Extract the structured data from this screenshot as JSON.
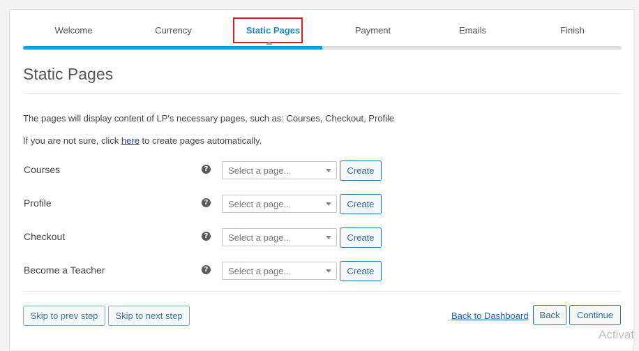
{
  "steps": [
    {
      "label": "Welcome"
    },
    {
      "label": "Currency"
    },
    {
      "label": "Static Pages",
      "active": true
    },
    {
      "label": "Payment"
    },
    {
      "label": "Emails"
    },
    {
      "label": "Finish"
    }
  ],
  "progress_fraction": 0.5,
  "page_title": "Static Pages",
  "description": "The pages will display content of LP's necessary pages, such as: Courses, Checkout, Profile",
  "auto_create": {
    "prefix": "If you are not sure, click ",
    "link_text": "here",
    "suffix": " to create pages automatically."
  },
  "page_rows": [
    {
      "label": "Courses",
      "select_placeholder": "Select a page...",
      "create_label": "Create"
    },
    {
      "label": "Profile",
      "select_placeholder": "Select a page...",
      "create_label": "Create"
    },
    {
      "label": "Checkout",
      "select_placeholder": "Select a page...",
      "create_label": "Create"
    },
    {
      "label": "Become a Teacher",
      "select_placeholder": "Select a page...",
      "create_label": "Create"
    }
  ],
  "help_icon_glyph": "?",
  "footer": {
    "skip_prev": "Skip to prev step",
    "skip_next": "Skip to next step",
    "back_to_dashboard": "Back to Dashboard",
    "back": "Back",
    "continue": "Continue"
  },
  "watermark": "Activat",
  "colors": {
    "accent": "#0ea0db",
    "active_step_text": "#1a8ec8",
    "highlight_box": "#e01b1b",
    "button_border": "#2a6e9e"
  }
}
